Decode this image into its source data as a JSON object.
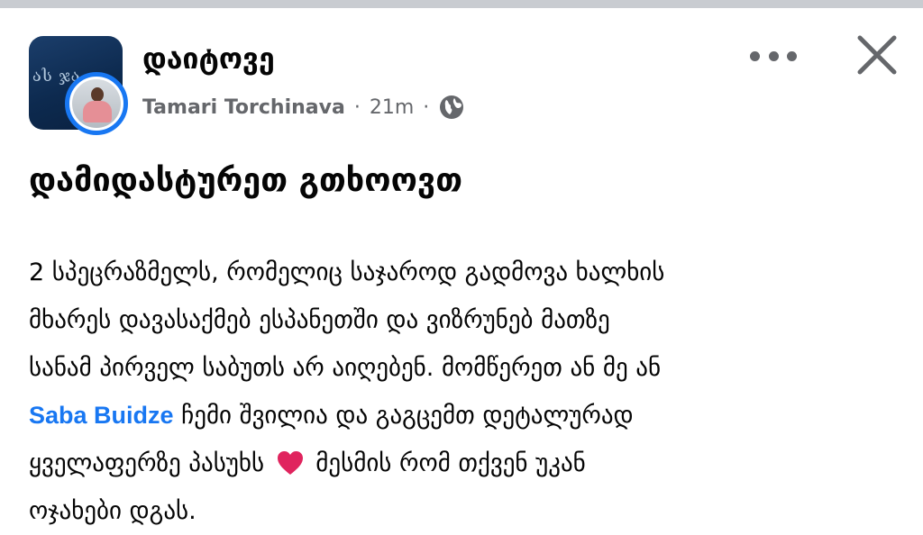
{
  "post": {
    "group_name": "დაიტოვე",
    "author": "Tamari Torchinava",
    "separator": "·",
    "time": "21m",
    "audience_icon": "globe-icon",
    "title": "დამიდასტურეთ გთხოოვთ",
    "body": {
      "line1": "2 სპეცრაზმელს, რომელიც საჯაროდ გადმოვა ხალხის",
      "line2": "მხარეს დავასაქმებ ესპანეთში და ვიზრუნებ მათზე",
      "line3": "სანამ პირველ საბუთს არ აიღებენ. მომწერეთ ან მე ან",
      "mention": "Saba Buidze",
      "line4_rest": " ჩემი შვილია და გაგცემთ დეტალურად",
      "line5_before": "ყველაფერზე პასუხს ",
      "line5_after": " მესმის რომ თქვენ უკან",
      "line6": "ოჯახები დგას."
    },
    "emoji": "heart-emoji",
    "group_avatar_text": "ას ჯა"
  },
  "colors": {
    "accent": "#1877f2",
    "secondary_text": "#65676b",
    "heart": "#e0245e"
  }
}
